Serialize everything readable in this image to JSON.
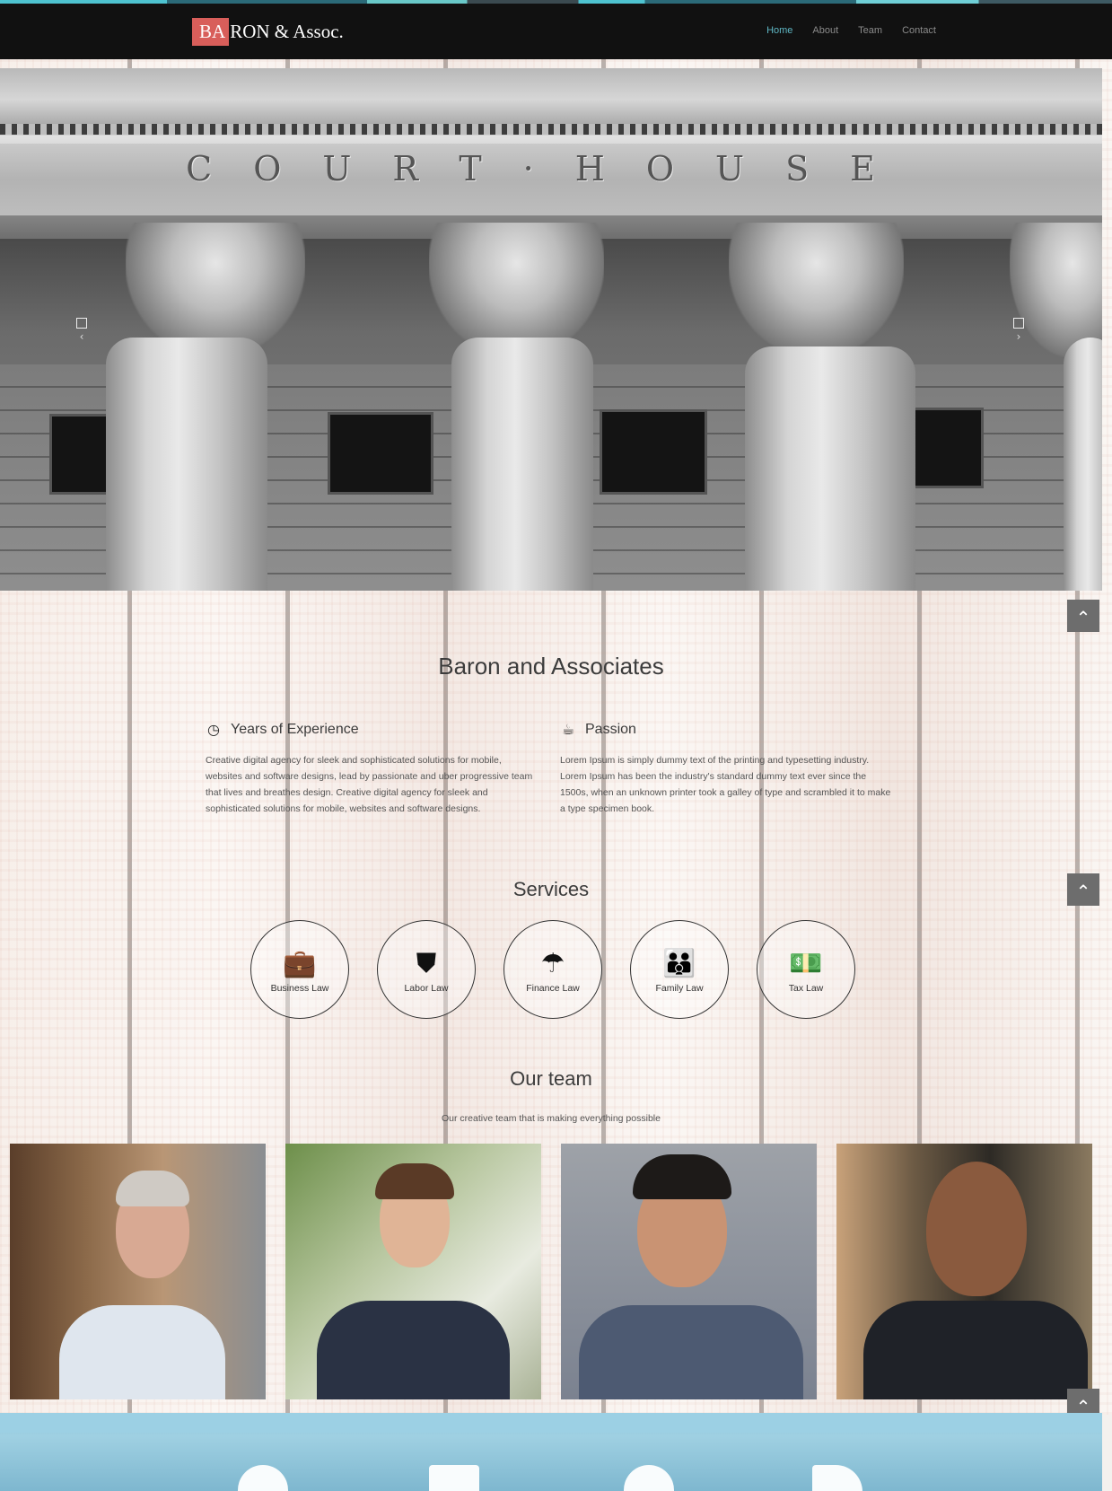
{
  "brand": {
    "mark": "BA",
    "rest": "RON & Assoc.",
    "accent": "#d85e5a"
  },
  "nav": {
    "items": [
      "Home",
      "About",
      "Team",
      "Contact"
    ],
    "active": "Home",
    "active_color": "#5fb7c4"
  },
  "hero": {
    "inscription": "COURT·HOUSE",
    "prev_icon": "chevron-left-icon",
    "next_icon": "chevron-right-icon"
  },
  "about": {
    "title": "Baron and Associates",
    "features": [
      {
        "icon": "clock-icon",
        "title": "Years of Experience",
        "text": "Creative digital agency for sleek and sophisticated solutions for mobile, websites and software designs, lead by passionate and uber progressive team that lives and breathes design. Creative digital agency for sleek and sophisticated solutions for mobile, websites and software designs."
      },
      {
        "icon": "coffee-icon",
        "title": "Passion",
        "text": "Lorem Ipsum is simply dummy text of the printing and typesetting industry. Lorem Ipsum has been the industry's standard dummy text ever since the 1500s, when an unknown printer took a galley of type and scrambled it to make a type specimen book."
      }
    ]
  },
  "services": {
    "title": "Services",
    "items": [
      {
        "label": "Business Law",
        "icon": "briefcase-icon"
      },
      {
        "label": "Labor Law",
        "icon": "shield-icon"
      },
      {
        "label": "Finance Law",
        "icon": "umbrella-icon"
      },
      {
        "label": "Family Law",
        "icon": "users-icon"
      },
      {
        "label": "Tax Law",
        "icon": "money-icon"
      }
    ]
  },
  "team": {
    "title": "Our team",
    "subtitle": "Our creative team that is making everything possible"
  },
  "scroll_top_icon": "chevron-up-icon"
}
